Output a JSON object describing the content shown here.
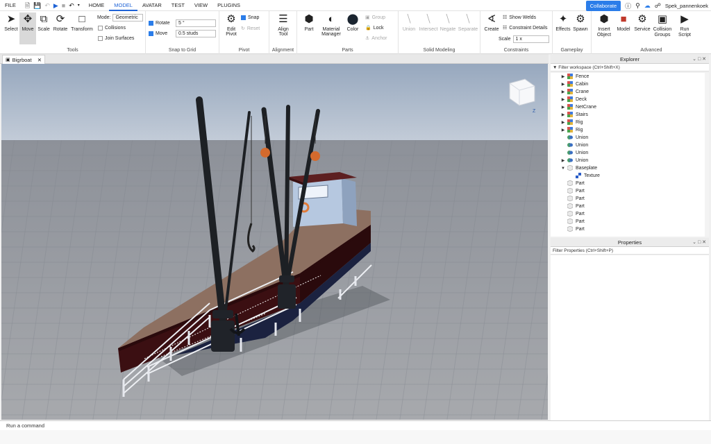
{
  "menubar": {
    "file": "FILE",
    "tabs": [
      "HOME",
      "MODEL",
      "AVATAR",
      "TEST",
      "VIEW",
      "PLUGINS"
    ],
    "active_tab": "MODEL",
    "collaborate": "Collaborate",
    "username": "Spek_pannenkoek"
  },
  "ribbon": {
    "tools": {
      "label": "Tools",
      "select": "Select",
      "move": "Move",
      "scale": "Scale",
      "rotate": "Rotate",
      "transform": "Transform",
      "mode_label": "Mode:",
      "mode_value": "Geometric",
      "collisions": "Collisions",
      "join_surfaces": "Join Surfaces"
    },
    "snap": {
      "label": "Snap to Grid",
      "rotate": "Rotate",
      "rotate_value": "5 °",
      "move": "Move",
      "move_value": "0.5 studs"
    },
    "pivot": {
      "label": "Pivot",
      "edit": "Edit Pivot",
      "snap": "Snap",
      "reset": "Reset"
    },
    "alignment": {
      "label": "Alignment",
      "align": "Align Tool"
    },
    "parts": {
      "label": "Parts",
      "part": "Part",
      "material": "Material Manager",
      "color": "Color",
      "group": "Group",
      "lock": "Lock",
      "anchor": "Anchor"
    },
    "solid": {
      "label": "Solid Modeling",
      "union": "Union",
      "intersect": "Intersect",
      "negate": "Negate",
      "separate": "Separate"
    },
    "constraints": {
      "label": "Constraints",
      "create": "Create",
      "show_welds": "Show Welds",
      "constraint_details": "Constraint Details",
      "scale": "Scale",
      "scale_value": "1 x"
    },
    "gameplay": {
      "label": "Gameplay",
      "effects": "Effects",
      "spawn": "Spawn"
    },
    "advanced": {
      "label": "Advanced",
      "insert": "Insert Object",
      "model": "Model",
      "service": "Service",
      "collision_groups": "Collision Groups",
      "run_script": "Run Script"
    }
  },
  "document_tab": {
    "title": "Bigrboat"
  },
  "explorer": {
    "title": "Explorer",
    "filter": "Filter workspace (Ctrl+Shift+X)",
    "items": [
      {
        "label": "Fence",
        "kind": "model",
        "indent": 0,
        "expand": "collapsed"
      },
      {
        "label": "Cabin",
        "kind": "model",
        "indent": 0,
        "expand": "collapsed"
      },
      {
        "label": "Crane",
        "kind": "model",
        "indent": 0,
        "expand": "collapsed"
      },
      {
        "label": "Deck",
        "kind": "model",
        "indent": 0,
        "expand": "collapsed"
      },
      {
        "label": "NetCrane",
        "kind": "model",
        "indent": 0,
        "expand": "collapsed"
      },
      {
        "label": "Stairs",
        "kind": "model",
        "indent": 0,
        "expand": "collapsed"
      },
      {
        "label": "Rig",
        "kind": "model",
        "indent": 0,
        "expand": "collapsed"
      },
      {
        "label": "Rig",
        "kind": "model",
        "indent": 0,
        "expand": "collapsed"
      },
      {
        "label": "Union",
        "kind": "union",
        "indent": 0,
        "expand": "none"
      },
      {
        "label": "Union",
        "kind": "union",
        "indent": 0,
        "expand": "none"
      },
      {
        "label": "Union",
        "kind": "union",
        "indent": 0,
        "expand": "none"
      },
      {
        "label": "Union",
        "kind": "union",
        "indent": 0,
        "expand": "collapsed"
      },
      {
        "label": "Baseplate",
        "kind": "part",
        "indent": 0,
        "expand": "expanded"
      },
      {
        "label": "Texture",
        "kind": "texture",
        "indent": 1,
        "expand": "none"
      },
      {
        "label": "Part",
        "kind": "part",
        "indent": 0,
        "expand": "none"
      },
      {
        "label": "Part",
        "kind": "part",
        "indent": 0,
        "expand": "none"
      },
      {
        "label": "Part",
        "kind": "part",
        "indent": 0,
        "expand": "none"
      },
      {
        "label": "Part",
        "kind": "part",
        "indent": 0,
        "expand": "none"
      },
      {
        "label": "Part",
        "kind": "part",
        "indent": 0,
        "expand": "none"
      },
      {
        "label": "Part",
        "kind": "part",
        "indent": 0,
        "expand": "none"
      },
      {
        "label": "Part",
        "kind": "part",
        "indent": 0,
        "expand": "none"
      }
    ]
  },
  "properties": {
    "title": "Properties",
    "filter": "Filter Properties (Ctrl+Shift+P)"
  },
  "command_bar": {
    "placeholder": "Run a command"
  },
  "colors": {
    "accent": "#2b7de9",
    "sky": "#aab7c9",
    "hull": "#3a0e10",
    "deck": "#8e7160"
  }
}
